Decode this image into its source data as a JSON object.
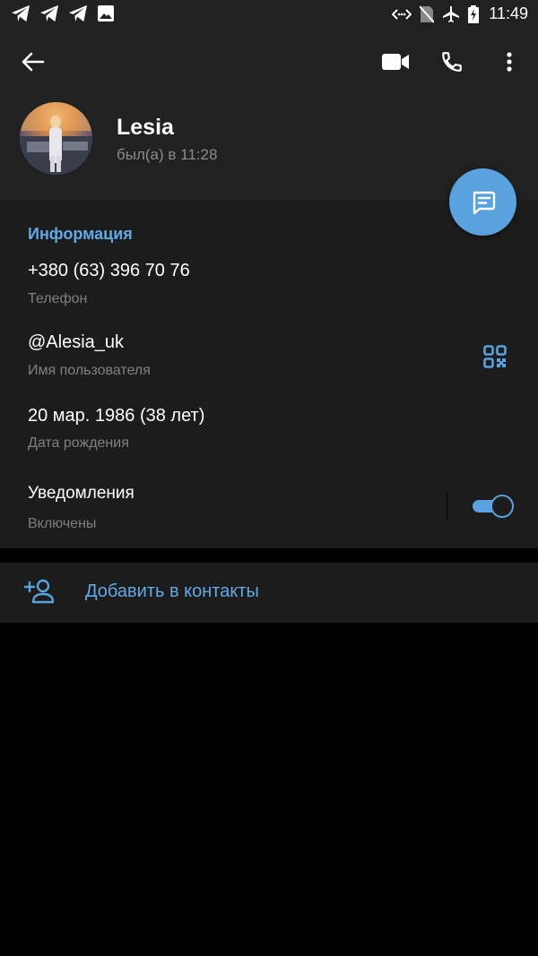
{
  "status_bar": {
    "time": "11:49",
    "left_icons": [
      "telegram-icon",
      "telegram-icon",
      "telegram-icon",
      "image-icon"
    ],
    "right_icons": [
      "data-sync-icon",
      "no-sim-icon",
      "airplane-icon",
      "battery-charging-icon"
    ]
  },
  "header": {
    "actions": [
      "back-arrow-icon",
      "video-call-icon",
      "phone-call-icon",
      "more-vert-icon"
    ],
    "name": "Lesia",
    "last_seen": "был(а) в 11:28"
  },
  "info": {
    "section_title": "Информация",
    "phone": {
      "value": "+380 (63) 396 70 76",
      "label": "Телефон"
    },
    "username": {
      "value": "@Alesia_uk",
      "label": "Имя пользователя"
    },
    "birthday": {
      "value": "20 мар. 1986 (38 лет)",
      "label": "Дата рождения"
    },
    "notifications": {
      "value": "Уведомления",
      "label": "Включены",
      "enabled": true
    }
  },
  "add_contact": {
    "label": "Добавить в контакты"
  },
  "colors": {
    "accent": "#5aa2dd",
    "link": "#62a9e5",
    "header_bg": "#212121",
    "section_bg": "#1c1c1c"
  }
}
